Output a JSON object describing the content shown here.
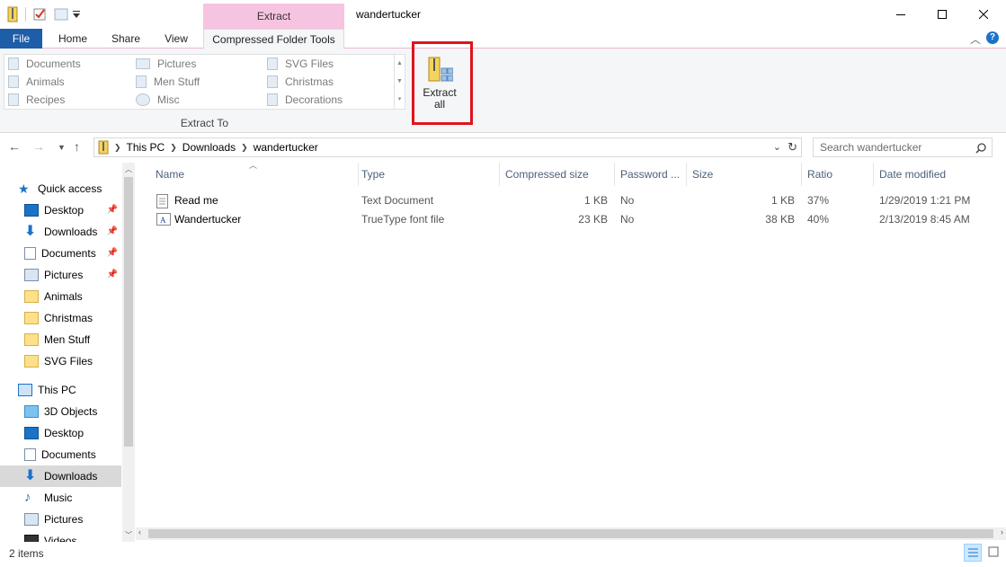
{
  "window": {
    "title": "wandertucker",
    "context_tab": "Extract"
  },
  "tabs": {
    "file": "File",
    "home": "Home",
    "share": "Share",
    "view": "View",
    "tools": "Compressed Folder Tools"
  },
  "ribbon": {
    "gallery": [
      [
        "Documents",
        "Pictures",
        "SVG Files"
      ],
      [
        "Animals",
        "Men Stuff",
        "Christmas"
      ],
      [
        "Recipes",
        "Misc",
        "Decorations"
      ]
    ],
    "group_label": "Extract To",
    "extract_all_line1": "Extract",
    "extract_all_line2": "all"
  },
  "address": {
    "crumbs": [
      "This PC",
      "Downloads",
      "wandertucker"
    ]
  },
  "search": {
    "placeholder": "Search wandertucker"
  },
  "nav": {
    "quick_access": "Quick access",
    "items": [
      "Desktop",
      "Downloads",
      "Documents",
      "Pictures",
      "Animals",
      "Christmas",
      "Men Stuff",
      "SVG Files"
    ],
    "this_pc": "This PC",
    "pc_items": [
      "3D Objects",
      "Desktop",
      "Documents",
      "Downloads",
      "Music",
      "Pictures",
      "Videos"
    ]
  },
  "columns": [
    "Name",
    "Type",
    "Compressed size",
    "Password ...",
    "Size",
    "Ratio",
    "Date modified"
  ],
  "files": [
    {
      "name": "Read me",
      "type": "Text Document",
      "compressed": "1 KB",
      "password": "No",
      "size": "1 KB",
      "ratio": "37%",
      "date": "1/29/2019 1:21 PM"
    },
    {
      "name": "Wandertucker",
      "type": "TrueType font file",
      "compressed": "23 KB",
      "password": "No",
      "size": "38 KB",
      "ratio": "40%",
      "date": "2/13/2019 8:45 AM"
    }
  ],
  "status": {
    "count": "2 items"
  },
  "colors": {
    "accent": "#1e5da8",
    "context": "#f6c4e0",
    "highlight": "#e0141e"
  }
}
